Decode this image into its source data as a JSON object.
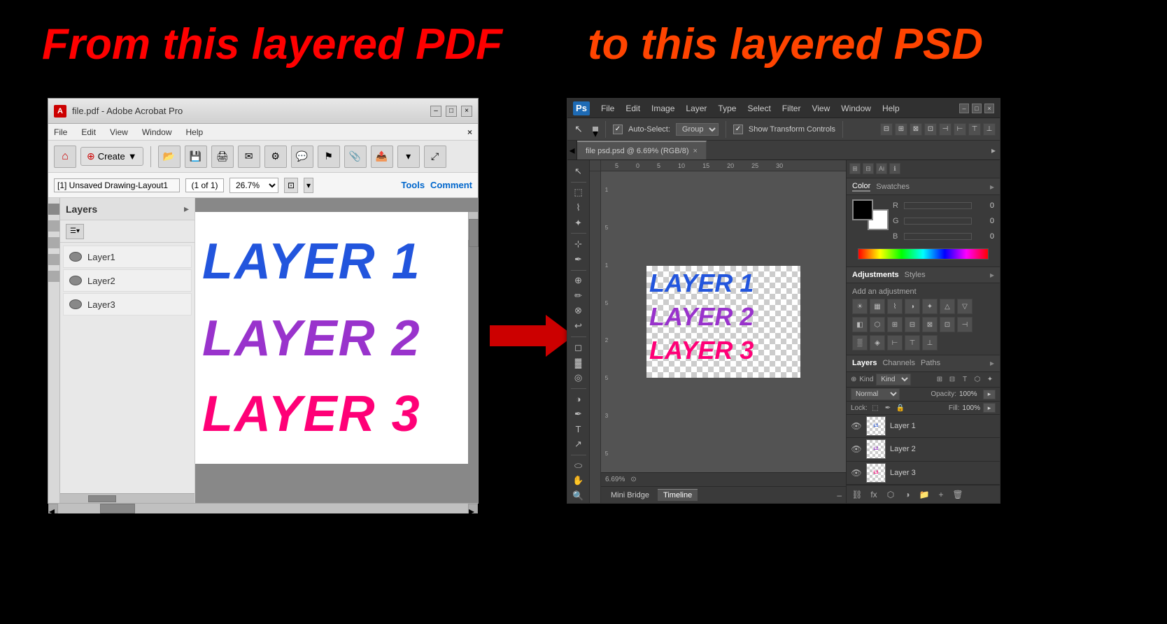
{
  "page": {
    "title_left": "From this layered PDF",
    "title_right": "to this layered PSD",
    "bg_color": "#000000"
  },
  "acrobat": {
    "titlebar": {
      "title": "file.pdf - Adobe Acrobat Pro",
      "icon_label": "A"
    },
    "menubar": {
      "items": [
        "File",
        "Edit",
        "View",
        "Window",
        "Help"
      ]
    },
    "toolbar": {
      "create_label": "Create",
      "create_arrow": "▼"
    },
    "nav": {
      "page_name": "[1] Unsaved Drawing-Layout1",
      "page_num": "(1 of 1)",
      "zoom": "26.7%",
      "tools_label": "Tools",
      "comment_label": "Comment"
    },
    "sidebar": {
      "title": "Layers",
      "layers": [
        {
          "name": "Layer1"
        },
        {
          "name": "Layer2"
        },
        {
          "name": "Layer3"
        }
      ]
    },
    "canvas": {
      "layer1_text": "LAYER 1",
      "layer2_text": "LAYER 2",
      "layer3_text": "LAYER 3"
    }
  },
  "arrow": {
    "color": "#cc0000"
  },
  "photoshop": {
    "menubar": {
      "app_label": "Ps",
      "items": [
        "File",
        "Edit",
        "Image",
        "Layer",
        "Type",
        "Select",
        "Filter",
        "View",
        "Window",
        "Help"
      ]
    },
    "options_bar": {
      "auto_select_label": "Auto-Select:",
      "auto_select_value": "Group",
      "show_transform_label": "Show Transform Controls",
      "checkbox_checked": "✓"
    },
    "doc_tab": {
      "title": "file psd.psd @ 6.69% (RGB/8)",
      "close": "×"
    },
    "canvas": {
      "layer1_text": "LAYER 1",
      "layer2_text": "LAYER 2",
      "layer3_text": "LAYER 3"
    },
    "status": {
      "zoom": "6.69%"
    },
    "bottom_tabs": {
      "mini_bridge": "Mini Bridge",
      "timeline": "Timeline"
    },
    "color_panel": {
      "tab_color": "Color",
      "tab_swatches": "Swatches",
      "r_value": "0",
      "g_value": "0",
      "b_value": "0"
    },
    "adj_panel": {
      "tab_adjustments": "Adjustments",
      "tab_styles": "Styles",
      "add_label": "Add an adjustment"
    },
    "layers_panel": {
      "tab_layers": "Layers",
      "tab_channels": "Channels",
      "tab_paths": "Paths",
      "kind_label": "⊕ Kind",
      "blend_mode": "Normal",
      "opacity_label": "Opacity:",
      "opacity_value": "100%",
      "lock_label": "Lock:",
      "fill_label": "Fill:",
      "fill_value": "100%",
      "layers": [
        {
          "name": "Layer 1",
          "thumb_color": "#2255dd"
        },
        {
          "name": "Layer 2",
          "thumb_color": "#9933cc"
        },
        {
          "name": "Layer 3",
          "thumb_color": "#ff0077"
        }
      ]
    }
  }
}
